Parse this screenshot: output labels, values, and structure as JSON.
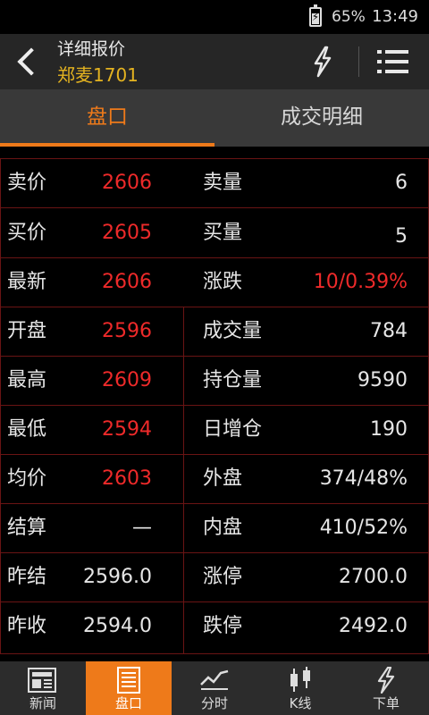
{
  "status_bar": {
    "battery_percent": "65%",
    "time": "13:49",
    "battery_level": 0.65
  },
  "header": {
    "title": "详细报价",
    "subtitle": "郑麦1701",
    "icons": [
      "back-arrow-icon",
      "lightning-icon",
      "menu-list-icon"
    ]
  },
  "tabs": [
    {
      "label": "盘口",
      "active": true
    },
    {
      "label": "成交明细",
      "active": false
    }
  ],
  "quote_rows": [
    {
      "label1": "卖价",
      "value1": "2606",
      "label2": "卖量",
      "value2": "6"
    },
    {
      "label1": "买价",
      "value1": "2605",
      "label2": "买量",
      "value2": "5"
    },
    {
      "label1": "最新",
      "value1": "2606",
      "label2": "涨跌",
      "value2": "10/0.39%"
    },
    {
      "label1": "开盘",
      "value1": "2596",
      "label2": "成交量",
      "value2": "784"
    },
    {
      "label1": "最高",
      "value1": "2609",
      "label2": "持仓量",
      "value2": "9590"
    },
    {
      "label1": "最低",
      "value1": "2594",
      "label2": "日增仓",
      "value2": "190"
    },
    {
      "label1": "均价",
      "value1": "2603",
      "label2": "外盘",
      "value2": "374/48%"
    },
    {
      "label1": "结算",
      "value1": "—",
      "label2": "内盘",
      "value2": "410/52%"
    },
    {
      "label1": "昨结",
      "value1": "2596.0",
      "label2": "涨停",
      "value2": "2700.0"
    },
    {
      "label1": "昨收",
      "value1": "2594.0",
      "label2": "跌停",
      "value2": "2492.0"
    }
  ],
  "colors": {
    "accent": "#ee7a1a",
    "price_red": "#ee2a2a",
    "title_gold": "#e4b320",
    "grid_line": "#6a1414"
  },
  "bottom_nav": [
    {
      "label": "新闻",
      "icon": "newspaper-icon",
      "active": false
    },
    {
      "label": "盘口",
      "icon": "order-book-icon",
      "active": true
    },
    {
      "label": "分时",
      "icon": "line-chart-icon",
      "active": false
    },
    {
      "label": "K线",
      "icon": "candlestick-icon",
      "active": false
    },
    {
      "label": "下单",
      "icon": "lightning-order-icon",
      "active": false
    }
  ]
}
